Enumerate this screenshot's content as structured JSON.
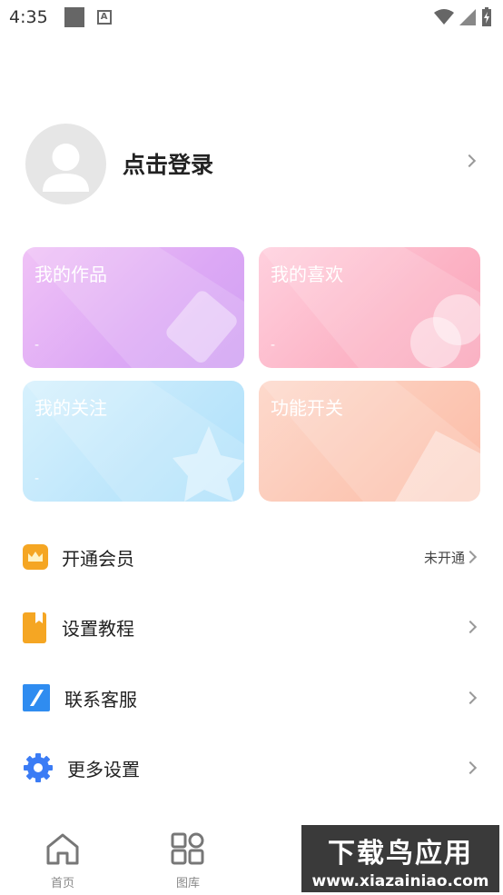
{
  "status_bar": {
    "time": "4:35",
    "a_icon": "A"
  },
  "profile": {
    "login_label": "点击登录"
  },
  "cards": [
    {
      "title": "我的作品",
      "value": "-"
    },
    {
      "title": "我的喜欢",
      "value": "-"
    },
    {
      "title": "我的关注",
      "value": "-"
    },
    {
      "title": "功能开关"
    }
  ],
  "menu": [
    {
      "label": "开通会员",
      "extra": "未开通",
      "icon": "crown-icon"
    },
    {
      "label": "设置教程",
      "icon": "bookmark-icon"
    },
    {
      "label": "联系客服",
      "icon": "pen-icon"
    },
    {
      "label": "更多设置",
      "icon": "gear-icon"
    }
  ],
  "tabs": [
    {
      "label": "首页",
      "icon": "home-icon"
    },
    {
      "label": "图库",
      "icon": "grid-icon"
    }
  ],
  "watermark": {
    "line1": "下载鸟应用",
    "line2": "www.xiazainiao.com"
  },
  "colors": {
    "crown_bg": "#f5a623",
    "bookmark": "#f5a623",
    "pen_bg": "#2f8cf0",
    "gear": "#3b7cf5"
  }
}
